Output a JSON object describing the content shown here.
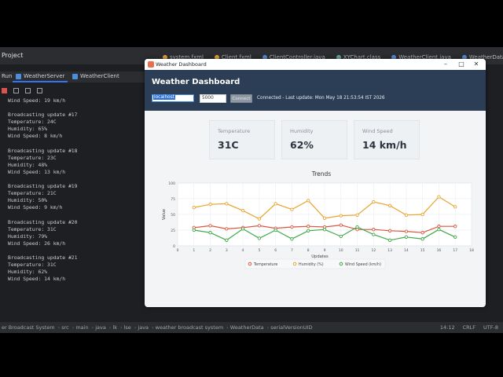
{
  "ide": {
    "project_label": "Project",
    "editor_tabs": [
      {
        "label": "system.fxml",
        "icon": "fxml-icon"
      },
      {
        "label": "Client.fxml",
        "icon": "fxml-icon"
      },
      {
        "label": "ClientController.java",
        "icon": "java-class-icon"
      },
      {
        "label": "XYChart.class",
        "icon": "class-file-icon"
      },
      {
        "label": "WeatherClient.java",
        "icon": "java-class-icon"
      },
      {
        "label": "WeatherData.java",
        "icon": "java-class-icon"
      }
    ],
    "run_tabs": [
      {
        "label": "Run"
      },
      {
        "label": "WeatherServer"
      },
      {
        "label": "WeatherClient"
      }
    ],
    "console_lines": [
      "Wind Speed: 19 km/h",
      "",
      "Broadcasting update #17",
      "Temperature: 24C",
      "Humidity: 65%",
      "Wind Speed: 8 km/h",
      "",
      "Broadcasting update #18",
      "Temperature: 23C",
      "Humidity: 48%",
      "Wind Speed: 13 km/h",
      "",
      "Broadcasting update #19",
      "Temperature: 21C",
      "Humidity: 50%",
      "Wind Speed: 9 km/h",
      "",
      "Broadcasting update #20",
      "Temperature: 31C",
      "Humidity: 79%",
      "Wind Speed: 26 km/h",
      "",
      "Broadcasting update #21",
      "Temperature: 31C",
      "Humidity: 62%",
      "Wind Speed: 14 km/h"
    ],
    "breadcrumbs": [
      "er Broadcast System",
      "src",
      "main",
      "java",
      "lk",
      "lse",
      "java",
      "weather broadcast system",
      "WeatherData",
      "serialVersionUID"
    ],
    "status_right": {
      "position": "14:12",
      "line_sep": "CRLF",
      "encoding": "UTF-8"
    }
  },
  "app": {
    "window_title": "Weather Dashboard",
    "header_title": "Weather Dashboard",
    "host_value": "localhost",
    "port_value": "5000",
    "connect_label": "Connect",
    "status_text": "Connected - Last update: Mon May 18 21:53:54 IST 2026",
    "cards": [
      {
        "label": "Temperature",
        "value": "31C"
      },
      {
        "label": "Humidity",
        "value": "62%"
      },
      {
        "label": "Wind Speed",
        "value": "14 km/h"
      }
    ]
  },
  "chart_data": {
    "type": "line",
    "title": "Trends",
    "xlabel": "Updates",
    "ylabel": "Value",
    "xlim": [
      0,
      18
    ],
    "ylim": [
      0,
      100
    ],
    "x_ticks": [
      0,
      1,
      2,
      3,
      4,
      5,
      6,
      7,
      8,
      9,
      10,
      11,
      12,
      13,
      14,
      15,
      16,
      17,
      18
    ],
    "y_ticks": [
      0,
      25,
      50,
      75,
      100
    ],
    "legend_position": "bottom",
    "grid": true,
    "x": [
      1,
      2,
      3,
      4,
      5,
      6,
      7,
      8,
      9,
      10,
      11,
      12,
      13,
      14,
      15,
      16,
      17
    ],
    "series": [
      {
        "name": "Temperature",
        "color": "#d9553e",
        "values": [
          29,
          32,
          27,
          29,
          32,
          28,
          30,
          31,
          30,
          33,
          26,
          26,
          24,
          23,
          21,
          31,
          31
        ]
      },
      {
        "name": "Humidity (%)",
        "color": "#e8a42e",
        "values": [
          61,
          66,
          67,
          56,
          43,
          67,
          58,
          72,
          44,
          48,
          49,
          70,
          64,
          49,
          50,
          78,
          62
        ]
      },
      {
        "name": "Wind Speed (km/h)",
        "color": "#3ea948",
        "values": [
          25,
          21,
          9,
          27,
          12,
          25,
          11,
          24,
          26,
          15,
          30,
          18,
          9,
          14,
          11,
          26,
          14
        ]
      }
    ]
  }
}
